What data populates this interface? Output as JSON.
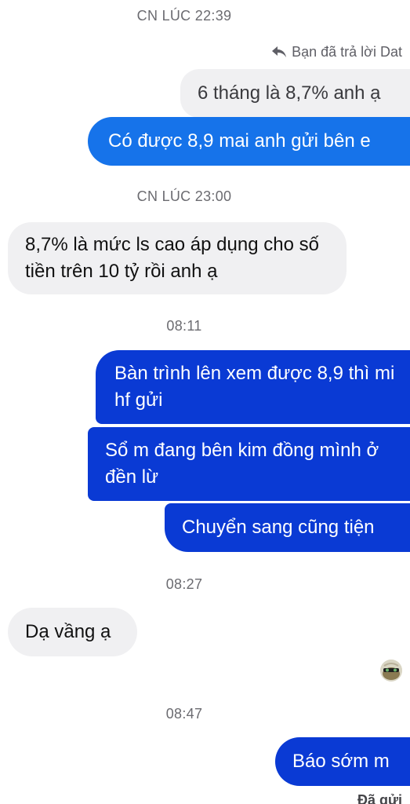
{
  "timestamps": {
    "t1": "CN LÚC 22:39",
    "t2": "CN LÚC 23:00",
    "t3": "08:11",
    "t4": "08:27",
    "t5": "08:47"
  },
  "reply_header": {
    "text": "Bạn đã trả lời Dat",
    "icon": "reply-arrow-icon"
  },
  "messages": {
    "quoted_reply": "6 tháng là 8,7% anh ạ",
    "out_1": "Có được 8,9 mai anh gửi bên e",
    "in_1": "8,7% là mức ls cao áp dụng cho số tiền trên 10 tỷ rồi anh ạ",
    "out_2": "Bàn trình lên xem được 8,9 thì mi hf gửi",
    "out_3": "Sổ m đang bên kim đồng mình ở đền lừ",
    "out_4": "Chuyển sang cũng tiện",
    "in_2": "Dạ vầng ạ",
    "out_5": "Báo sớm m"
  },
  "read_receipt": {
    "icon": "seen-avatar-icon"
  },
  "status": {
    "sent": "Đã gửi"
  },
  "colors": {
    "incoming_bubble": "#f0f0f2",
    "outgoing_light": "#1673ea",
    "outgoing_dark": "#0a3ad4",
    "timestamp": "#6b6b70"
  }
}
